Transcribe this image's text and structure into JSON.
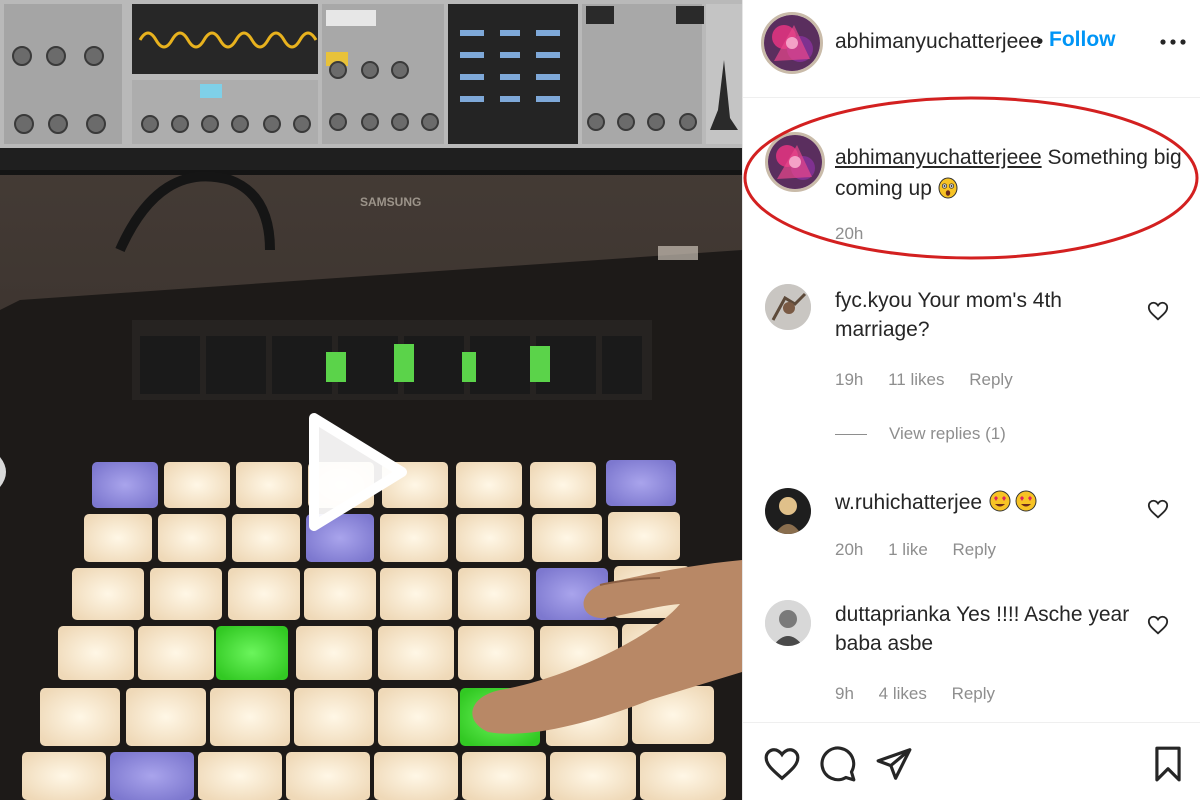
{
  "post": {
    "author": "abhimanyuchatterjeee",
    "follow_label": "Follow",
    "separator": "•",
    "more_icon": "more-options-icon"
  },
  "media": {
    "type": "video",
    "device_brand_text": "SAMSUNG",
    "play_icon": "play-icon",
    "prev_icon": "chevron-left-icon"
  },
  "caption": {
    "user": "abhimanyuchatterjeee",
    "text": "Something big coming up",
    "emoji": "astonished-face-emoji",
    "time": "20h"
  },
  "comments": [
    {
      "user": "fyc.kyou",
      "text": "Your mom's 4th marriage?",
      "time": "19h",
      "likes": "11 likes",
      "reply": "Reply",
      "view_replies": "View replies (1)"
    },
    {
      "user": "w.ruhichatterjee",
      "text": "",
      "emoji": "heart-eyes-emoji x2",
      "time": "20h",
      "likes": "1 like",
      "reply": "Reply"
    },
    {
      "user": "duttaprianka",
      "text": "Yes !!!! Asche year baba asbe",
      "time": "9h",
      "likes": "4 likes",
      "reply": "Reply"
    }
  ],
  "action_bar": {
    "icons": [
      "heart-icon",
      "comment-icon",
      "share-icon",
      "bookmark-icon"
    ]
  },
  "colors": {
    "link_blue": "#0095f6",
    "meta_gray": "#8e8e8e",
    "annotation_red": "#d32020",
    "pad_cream": "#f3e4c9",
    "pad_purple": "#8c87d8",
    "pad_green": "#3ee52e"
  }
}
